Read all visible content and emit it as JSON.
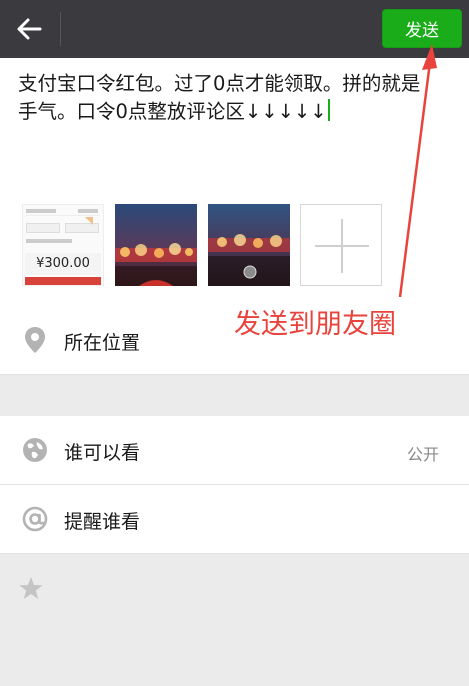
{
  "header": {
    "back_icon": "arrow-left-icon",
    "send_label": "发送"
  },
  "compose": {
    "text": "支付宝口令红包。过了0点才能领取。拼的就是手气。口令0点整放评论区↓↓↓↓↓"
  },
  "thumbnails": [
    {
      "kind": "redpacket-screenshot",
      "amount": "¥300.00"
    },
    {
      "kind": "photo-night-lights"
    },
    {
      "kind": "photo-night-lights"
    }
  ],
  "location": {
    "icon": "location-pin-icon",
    "label": "所在位置"
  },
  "visibility": {
    "icon": "globe-icon",
    "label": "谁可以看",
    "value": "公开"
  },
  "mention": {
    "icon": "at-sign-icon",
    "label": "提醒谁看"
  },
  "extra_icon": "star-icon",
  "annotation": {
    "text": "发送到朋友圈",
    "color": "#e8433c"
  },
  "colors": {
    "topbar": "#3a3a3f",
    "send_button": "#1aad19",
    "background": "#ebebeb"
  }
}
